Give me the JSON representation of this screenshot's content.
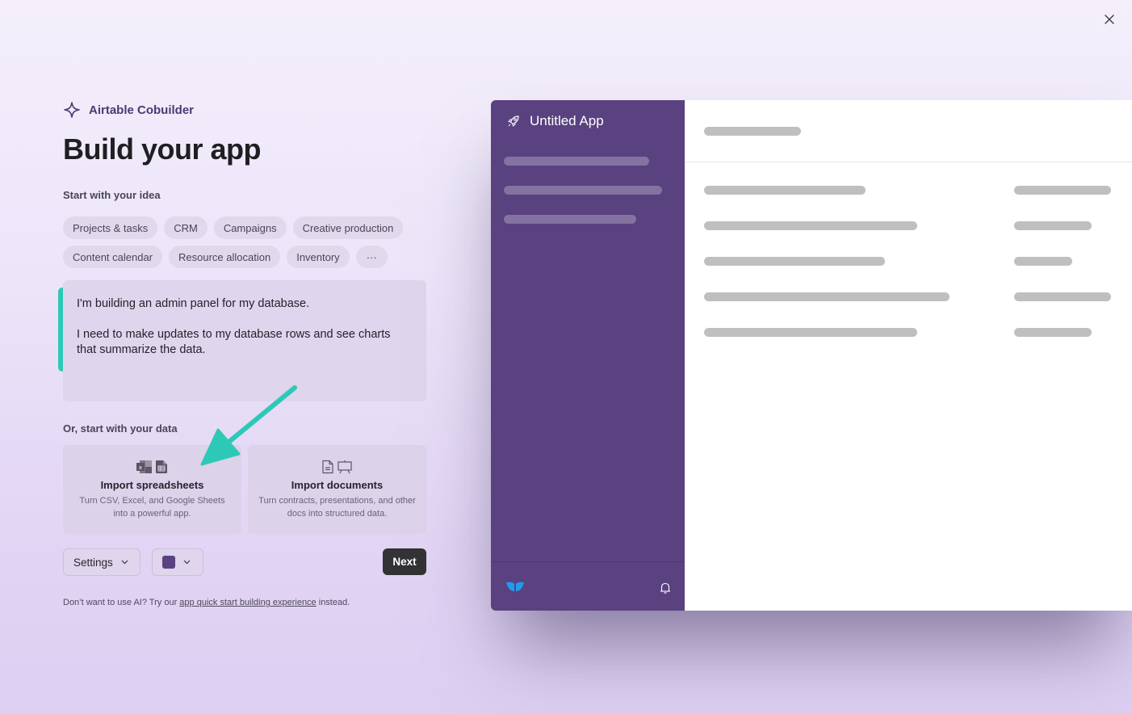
{
  "window": {
    "close_icon": "close-icon"
  },
  "brand": {
    "name": "Airtable Cobuilder",
    "icon": "sparkle-icon"
  },
  "page_title": "Build your app",
  "idea_section": {
    "label": "Start with your idea",
    "chips": [
      "Projects & tasks",
      "CRM",
      "Campaigns",
      "Creative production",
      "Content calendar",
      "Resource allocation",
      "Inventory",
      "···"
    ]
  },
  "prompt": {
    "lines": [
      "I'm building an admin panel for my database.",
      "I need to make updates to my database rows and see charts that summarize the data."
    ]
  },
  "data_section": {
    "label": "Or, start with your data",
    "cards": [
      {
        "title": "Import spreadsheets",
        "description": "Turn CSV, Excel, and Google Sheets into a powerful app.",
        "icons": [
          "excel-icon",
          "sheets-icon"
        ]
      },
      {
        "title": "Import documents",
        "description": "Turn contracts, presentations, and other docs into structured data.",
        "icons": [
          "document-icon",
          "presentation-icon"
        ]
      }
    ]
  },
  "controls": {
    "settings_label": "Settings",
    "color_value": "#59427f",
    "next_label": "Next"
  },
  "footnote": {
    "prefix": "Don’t want to use AI? Try our ",
    "link": "app quick start building experience",
    "suffix": " instead."
  },
  "preview": {
    "app_name": "Untitled App",
    "app_icon": "rocket-icon",
    "sidebar_color": "#59427f",
    "footer_logo": "airtable-logo-icon",
    "footer_bell": "bell-icon"
  },
  "colors": {
    "accent_teal": "#2ec9b6",
    "brand_purple": "#59427f",
    "primary_button": "#333235"
  }
}
